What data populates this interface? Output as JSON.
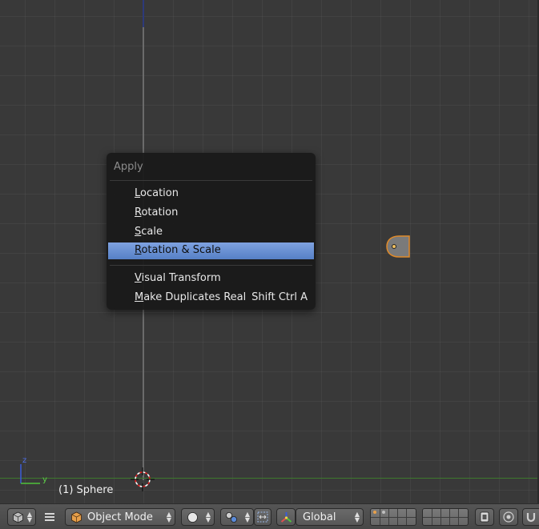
{
  "menu": {
    "title": "Apply",
    "items": [
      {
        "label": "Location",
        "mnemonic": "L",
        "rest": "ocation",
        "shortcut": "",
        "highlighted": false
      },
      {
        "label": "Rotation",
        "mnemonic": "R",
        "rest": "otation",
        "shortcut": "",
        "highlighted": false
      },
      {
        "label": "Scale",
        "mnemonic": "S",
        "rest": "cale",
        "shortcut": "",
        "highlighted": false
      },
      {
        "label": "Rotation & Scale",
        "mnemonic": "R",
        "rest": "otation & Scale",
        "shortcut": "",
        "highlighted": true
      },
      {
        "label": "Visual Transform",
        "mnemonic": "V",
        "rest": "isual Transform",
        "shortcut": "",
        "highlighted": false
      },
      {
        "label": "Make Duplicates Real",
        "mnemonic": "M",
        "rest": "ake Duplicates Real",
        "shortcut": "Shift Ctrl A",
        "highlighted": false
      }
    ]
  },
  "viewport": {
    "object_label": "(1) Sphere",
    "gizmo": {
      "z_label": "z",
      "y_label": "y"
    }
  },
  "header": {
    "mode": "Object Mode",
    "orientation": "Global",
    "editor_icon": "cube-editor-icon",
    "shading_icon": "solid-sphere-icon",
    "pivot_icon": "pivot-point-icon",
    "manipulator_icon": "transform-manipulator-icon"
  },
  "colors": {
    "highlight": "#5680c6",
    "selection_outline": "#e08a2a",
    "axis_x": "#3d7a2d",
    "axis_z": "#2d3a7a"
  }
}
